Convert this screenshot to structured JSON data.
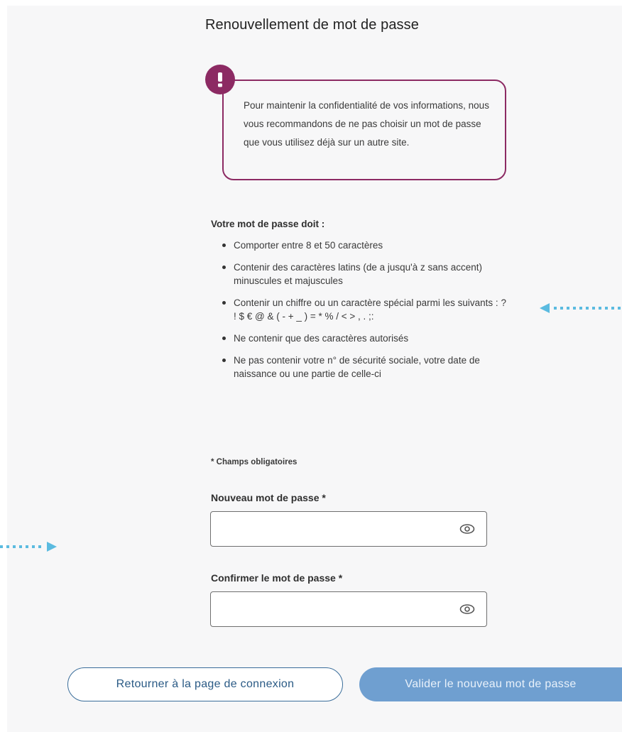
{
  "page": {
    "title": "Renouvellement de mot de passe"
  },
  "alert": {
    "icon": "exclamation-icon",
    "icon_glyph": "!",
    "text": "Pour maintenir la confidentialité de vos informations, nous vous recommandons de ne pas choisir un mot de passe que vous utilisez déjà sur un autre site.",
    "border_color": "#8c2a63"
  },
  "rules": {
    "title": "Votre mot de passe doit :",
    "items": [
      "Comporter entre 8 et 50 caractères",
      "Contenir des caractères latins (de a jusqu'à z sans accent) minuscules et majuscules",
      "Contenir un chiffre ou un caractère spécial parmi les suivants : ? ! $ € @ & ( - + _ ) = * % / < > , . ;:",
      "Ne contenir que des caractères autorisés",
      "Ne pas contenir votre n° de sécurité sociale, votre date de naissance ou une partie de celle-ci"
    ]
  },
  "form": {
    "required_note": "* Champs obligatoires",
    "new_password": {
      "label": "Nouveau mot de passe *",
      "value": "",
      "toggle_icon": "eye-icon"
    },
    "confirm_password": {
      "label": "Confirmer le mot de passe *",
      "value": "",
      "toggle_icon": "eye-icon"
    }
  },
  "actions": {
    "back_label": "Retourner à la page de connexion",
    "submit_label": "Valider le nouveau mot de passe",
    "submit_color": "#6f9fd0"
  },
  "annotations": {
    "arrow_color": "#5bbbe0",
    "arrows": [
      "arrow-left-icon",
      "arrow-right-icon"
    ]
  }
}
